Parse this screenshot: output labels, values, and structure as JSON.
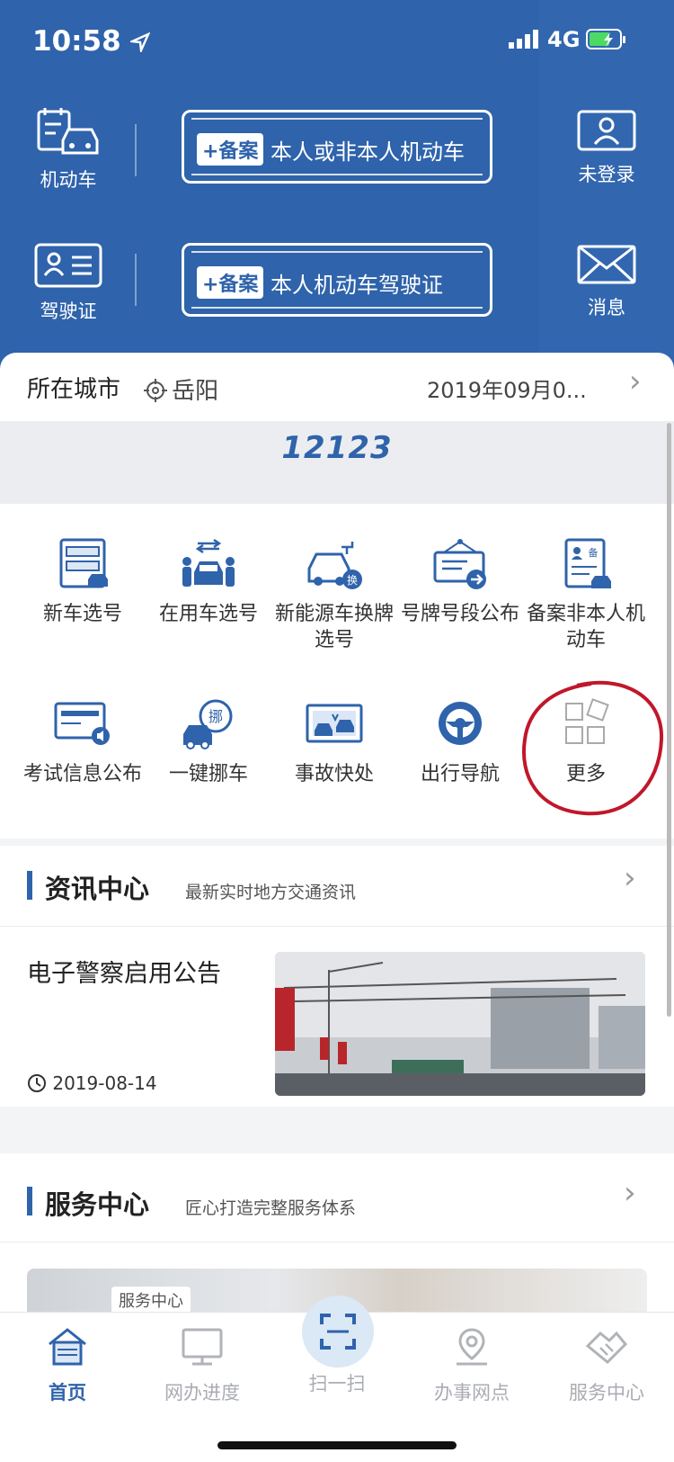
{
  "status_bar": {
    "time": "10:58",
    "network": "4G"
  },
  "header": {
    "row1": {
      "left_label": "机动车",
      "tag": "+备案",
      "text": "本人或非本人机动车",
      "right_label": "未登录"
    },
    "row2": {
      "left_label": "驾驶证",
      "tag": "+备案",
      "text": "本人机动车驾驶证",
      "right_label": "消息"
    }
  },
  "city": {
    "label": "所在城市",
    "name": "岳阳",
    "date": "2019年09月0..."
  },
  "banner": {
    "text": "12123"
  },
  "services": [
    {
      "label": "新车选号"
    },
    {
      "label": "在用车选号"
    },
    {
      "label": "新能源车换牌选号"
    },
    {
      "label": "号牌号段公布"
    },
    {
      "label": "备案非本人机动车"
    },
    {
      "label": "考试信息公布"
    },
    {
      "label": "一键挪车"
    },
    {
      "label": "事故快处"
    },
    {
      "label": "出行导航"
    },
    {
      "label": "更多"
    }
  ],
  "news": {
    "title": "资讯中心",
    "subtitle": "最新实时地方交通资讯",
    "item": {
      "headline": "电子警察启用公告",
      "date": "2019-08-14"
    }
  },
  "service_center": {
    "title": "服务中心",
    "subtitle": "匠心打造完整服务体系",
    "image_badge": "服务中心"
  },
  "tabbar": {
    "tabs": [
      {
        "label": "首页"
      },
      {
        "label": "网办进度"
      },
      {
        "label": "扫一扫"
      },
      {
        "label": "办事网点"
      },
      {
        "label": "服务中心"
      }
    ],
    "active": "首页"
  },
  "colors": {
    "primary": "#2f63ab",
    "annotation_red": "#c0172b"
  }
}
